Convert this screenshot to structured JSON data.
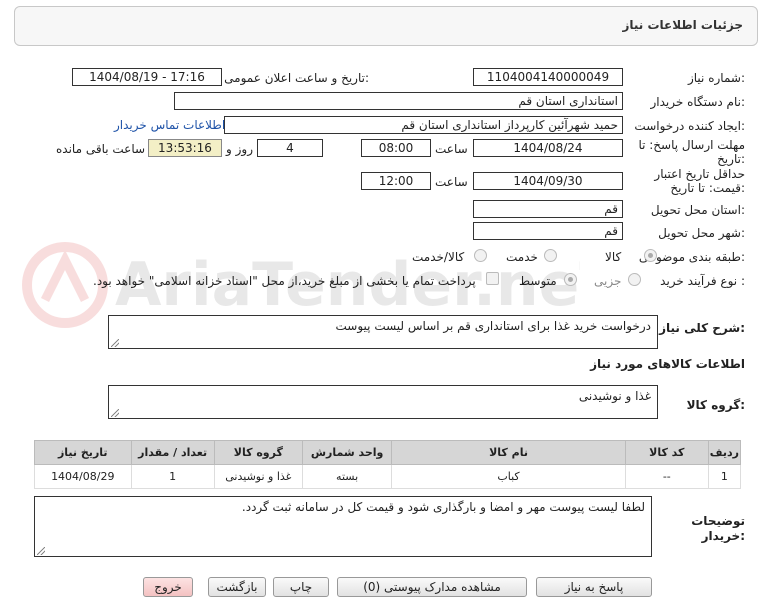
{
  "header": {
    "title": "جزئیات اطلاعات نیاز"
  },
  "form": {
    "need_number_label": "شماره نیاز:",
    "need_number": "1104004140000049",
    "announce_label": "تاریخ و ساعت اعلان عمومی:",
    "announce_value": "1404/08/19 - 17:16",
    "buyer_org_label": "نام دستگاه خریدار:",
    "buyer_org": "استانداری استان قم",
    "requester_label": "ایجاد کننده درخواست:",
    "requester": "حمید شهرآئین کارپرداز استانداری استان قم",
    "contact_link": "اطلاعات تماس خریدار",
    "deadline_label_1": "مهلت ارسال پاسخ: تا",
    "deadline_label_2": "تاریخ:",
    "deadline_date": "1404/08/24",
    "time_label": "ساعت",
    "deadline_time": "08:00",
    "days_value": "4",
    "days_label": "روز و",
    "remaining_time": "13:53:16",
    "remaining_label": "ساعت باقی مانده",
    "validity_label_1": "حداقل تاریخ اعتبار",
    "validity_label_2": "قیمت: تا تاریخ:",
    "validity_date": "1404/09/30",
    "validity_time_label": "ساعت",
    "validity_time": "12:00",
    "province_label": "استان محل تحویل:",
    "province": "قم",
    "city_label": "شهر محل تحویل:",
    "city": "قم",
    "category_label": "طبقه بندی موضوعی:",
    "category_options": [
      "کالا",
      "خدمت",
      "کالا/خدمت"
    ],
    "process_label": "نوع فرآیند خرید :",
    "process_options": [
      "جزیی",
      "متوسط"
    ],
    "payment_note": "پرداخت تمام یا بخشی از مبلغ خرید،از محل \"اسناد خزانه اسلامی\" خواهد بود."
  },
  "description": {
    "label": "شرح کلی نیاز:",
    "text": "درخواست خرید غذا برای استانداری قم بر اساس لیست پیوست"
  },
  "goods": {
    "section_title": "اطلاعات کالاهای مورد نیاز",
    "group_label": "گروه کالا:",
    "group_value": "غذا و نوشیدنی",
    "columns": [
      "ردیف",
      "کد کالا",
      "نام کالا",
      "واحد شمارش",
      "گروه کالا",
      "تعداد / مقدار",
      "تاریخ نیاز"
    ],
    "rows": [
      [
        "1",
        "--",
        "کباب",
        "بسته",
        "غذا و نوشیدنی",
        "1",
        "1404/08/29"
      ]
    ]
  },
  "buyer_notes": {
    "label_1": "توضیحات",
    "label_2": "خریدار:",
    "text": "لطفا لیست پیوست مهر و امضا و بارگذاری شود و قیمت کل در سامانه ثبت گردد."
  },
  "buttons": {
    "respond": "پاسخ به نیاز",
    "view_attachments": "مشاهده مدارک پیوستی (0)",
    "print": "چاپ",
    "back": "بازگشت",
    "exit": "خروج"
  },
  "watermark": {
    "text": "AriaTender.neT"
  },
  "colors": {
    "link": "#1f53a8",
    "highlight": "#f3efc6",
    "exit_button": "#f4c2c2",
    "table_header": "#d6d6d6"
  }
}
